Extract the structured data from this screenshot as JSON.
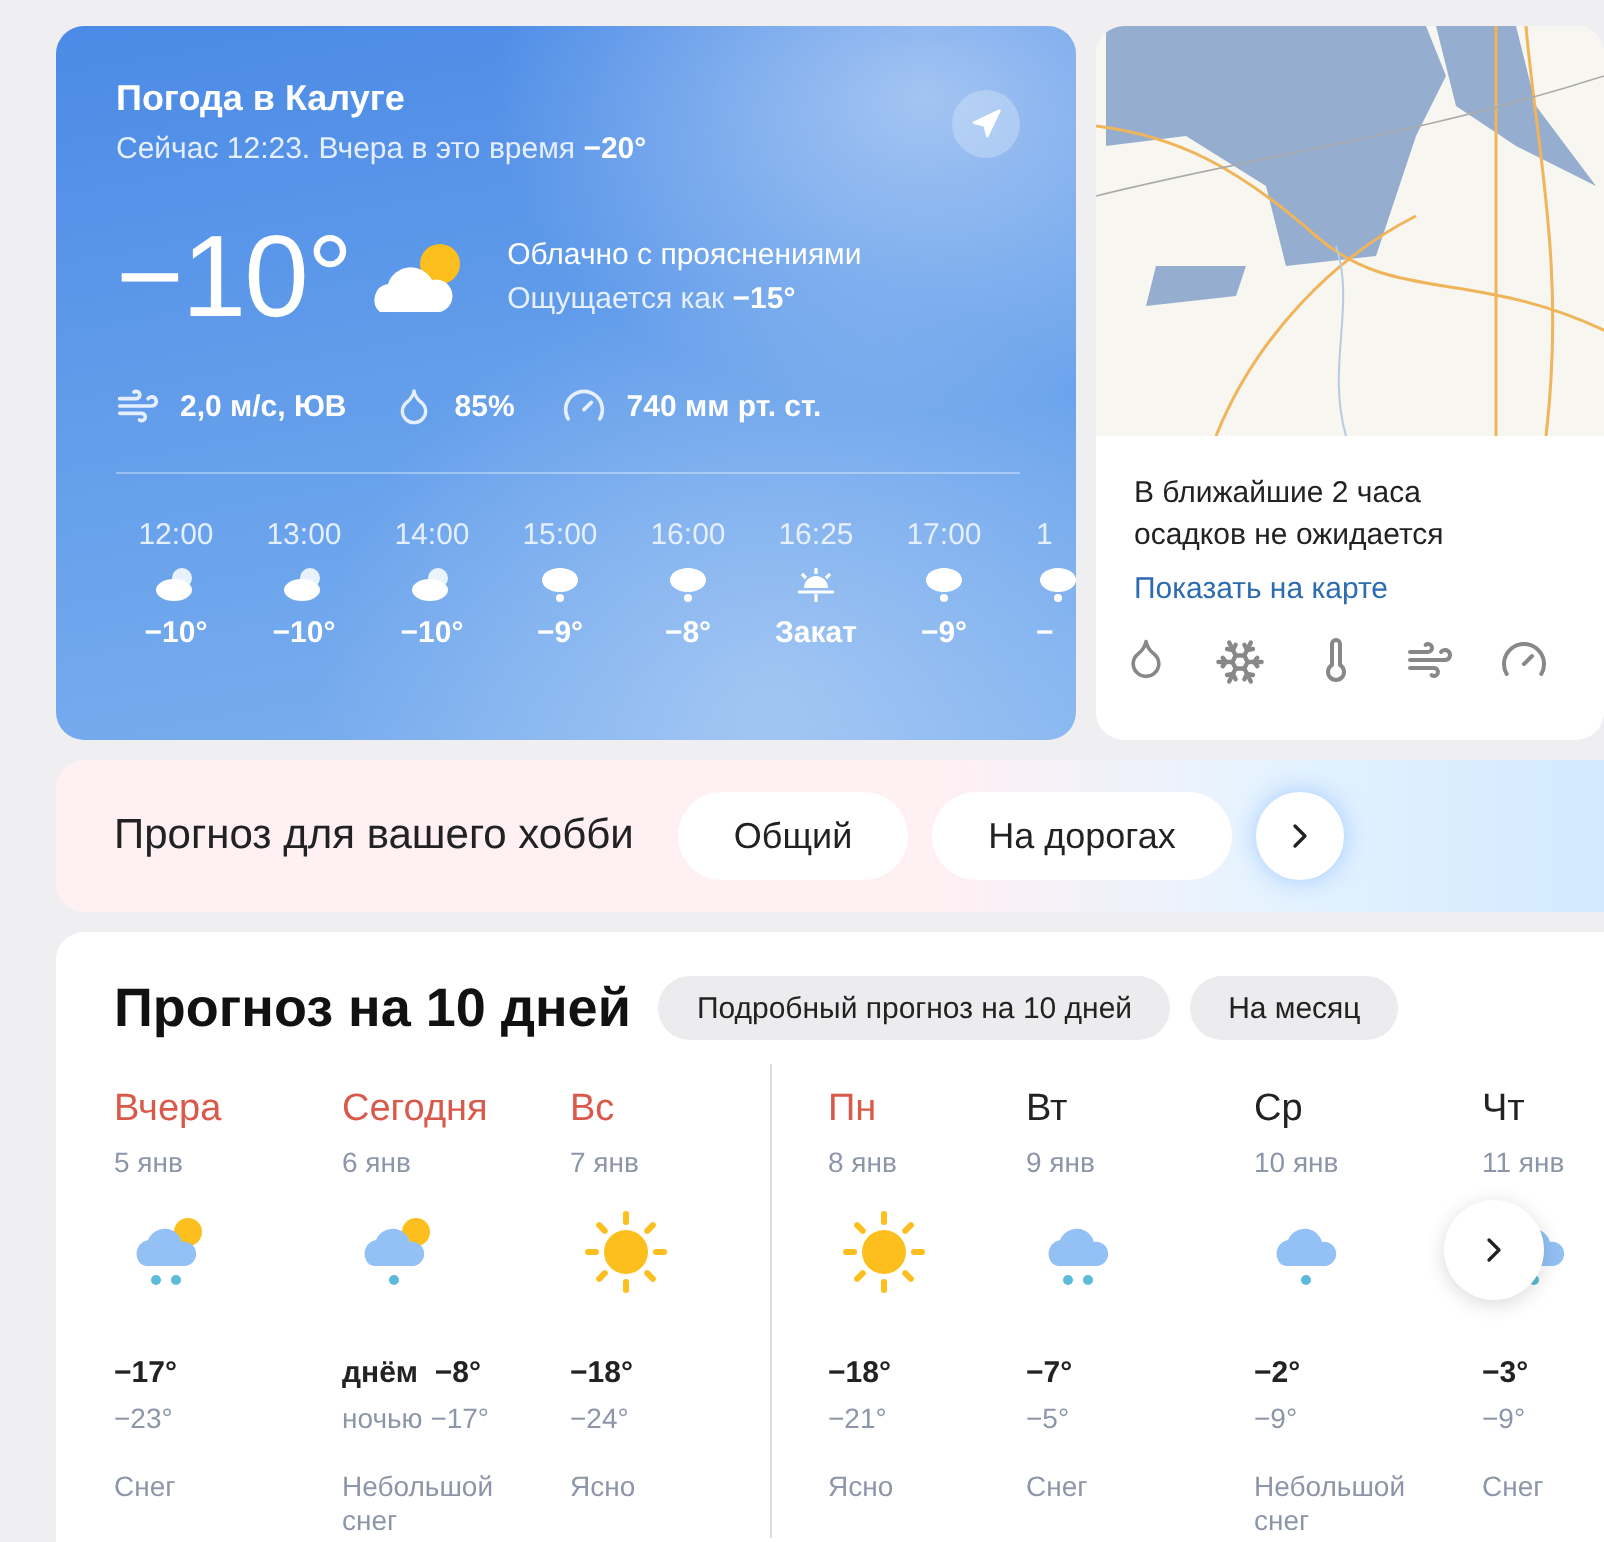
{
  "current": {
    "title": "Погода в Калуге",
    "subtitle": "Сейчас 12:23. Вчера в это время **−20°**",
    "temperature": "−10°",
    "condition": "Облачно с прояснениями",
    "feels_like": "Ощущается как **−15°**",
    "wind": "2,0 м/с, ЮВ",
    "humidity": "85%",
    "pressure": "740 мм рт. ст.",
    "hourly": [
      {
        "time": "12:00",
        "kind": "cloud_sun",
        "temp": "−10°"
      },
      {
        "time": "13:00",
        "kind": "cloud_sun",
        "temp": "−10°"
      },
      {
        "time": "14:00",
        "kind": "cloud_sun",
        "temp": "−10°"
      },
      {
        "time": "15:00",
        "kind": "cloud_snow",
        "temp": "−9°"
      },
      {
        "time": "16:00",
        "kind": "cloud_snow",
        "temp": "−8°"
      },
      {
        "time": "16:25",
        "kind": "sunset",
        "temp": "Закат"
      },
      {
        "time": "17:00",
        "kind": "cloud_snow",
        "temp": "−9°"
      },
      {
        "time": "1",
        "kind": "cloud_snow",
        "temp": "−"
      }
    ]
  },
  "nowcast": {
    "message": "В ближайшие 2 часа осадков не ожидается",
    "link": "Показать на карте"
  },
  "hobby": {
    "title": "Прогноз для вашего хобби",
    "tabs": [
      {
        "label": "Общий",
        "selected": false
      },
      {
        "label": "На дорогах",
        "selected": false
      }
    ]
  },
  "forecast": {
    "title": "Прогноз на 10 дней",
    "buttons": [
      "Подробный прогноз на 10 дней",
      "На месяц"
    ],
    "days": [
      {
        "name": "Вчера",
        "date": "5 янв",
        "holiday": true,
        "separator": false,
        "kind": "sun_cloud_heavy_snow",
        "high": "−17°",
        "low": "−23°",
        "condition": "Снег"
      },
      {
        "name": "Сегодня",
        "date": "6 янв",
        "holiday": true,
        "separator": false,
        "kind": "sun_cloud_light_snow",
        "high": "днём  −8°",
        "low": "ночью −17°",
        "condition": "Небольшой снег"
      },
      {
        "name": "Вс",
        "date": "7 янв",
        "holiday": true,
        "separator": false,
        "kind": "sun",
        "high": "−18°",
        "low": "−24°",
        "condition": "Ясно"
      },
      {
        "name": "Пн",
        "date": "8 янв",
        "holiday": true,
        "separator": true,
        "kind": "sun",
        "high": "−18°",
        "low": "−21°",
        "condition": "Ясно"
      },
      {
        "name": "Вт",
        "date": "9 янв",
        "holiday": false,
        "separator": false,
        "kind": "cloud_heavy_snow",
        "high": "−7°",
        "low": "−5°",
        "condition": "Снег"
      },
      {
        "name": "Ср",
        "date": "10 янв",
        "holiday": false,
        "separator": false,
        "kind": "cloud_light_snow",
        "high": "−2°",
        "low": "−9°",
        "condition": "Небольшой снег"
      },
      {
        "name": "Чт",
        "date": "11 янв",
        "holiday": false,
        "separator": false,
        "kind": "cloud_light_snow",
        "high": "−3°",
        "low": "−9°",
        "condition": "Снег"
      }
    ]
  }
}
